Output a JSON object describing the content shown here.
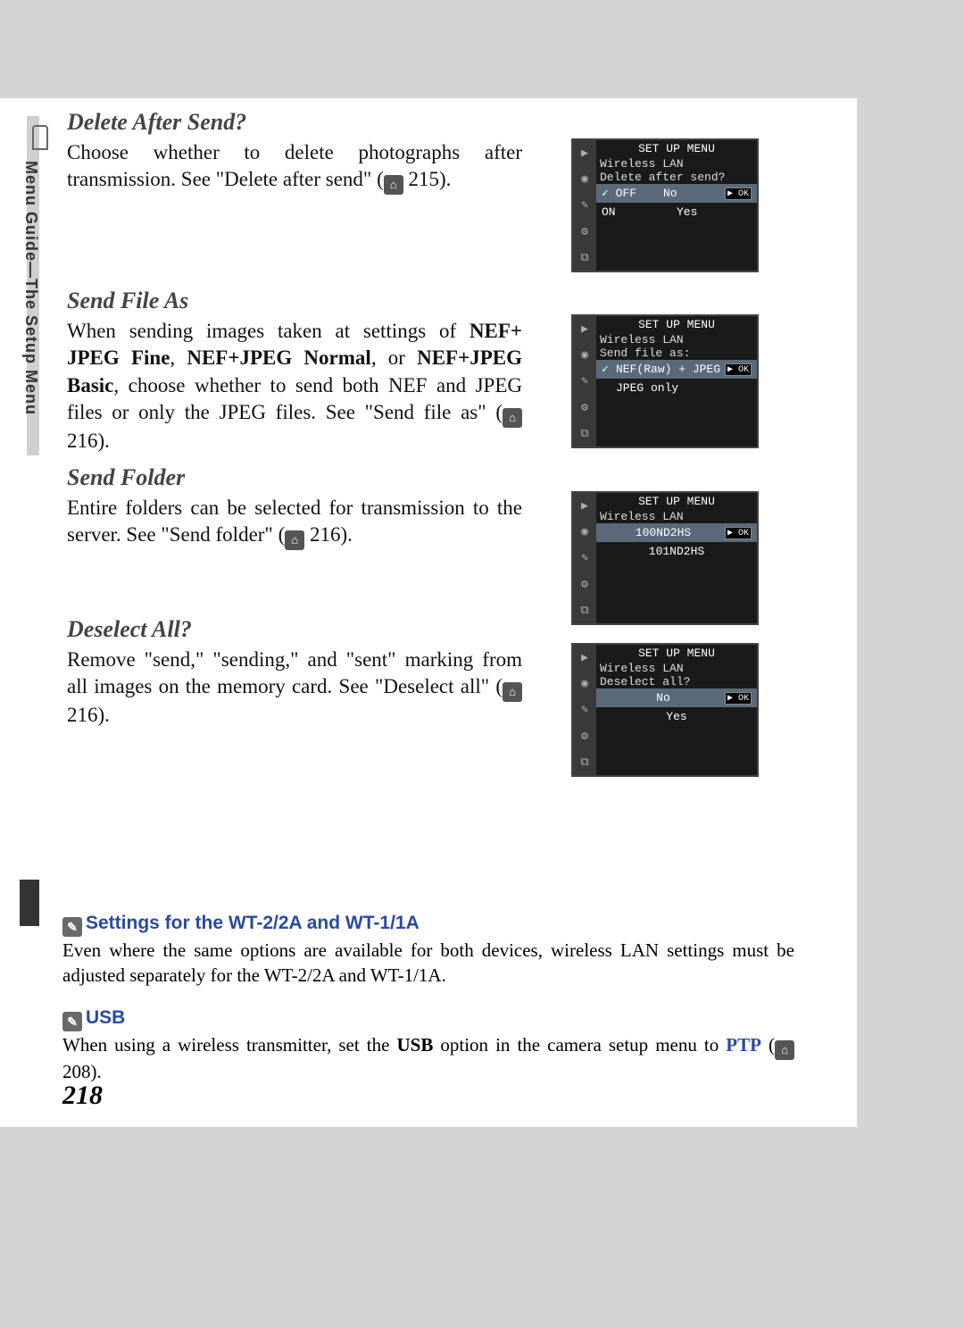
{
  "sidebar_label": "Menu Guide—The Setup Menu",
  "page_number": "218",
  "sections": {
    "s1": {
      "title": "Delete After Send?",
      "body_before": "Choose whether to delete photographs after transmission.  See \"Delete after send\" (",
      "ref": " 215)."
    },
    "s2": {
      "title": "Send File As",
      "body_p1": "When sending images taken at settings of ",
      "b1": "NEF+ JPEG Fine",
      "body_p2": ", ",
      "b2": "NEF+JPEG Normal",
      "body_p3": ", or ",
      "b3": "NEF+JPEG Basic",
      "body_p4": ", choose whether to send both NEF and JPEG files or only the JPEG files.  See \"Send file as\" (",
      "ref": " 216)."
    },
    "s3": {
      "title": "Send Folder",
      "body_before": "Entire folders can be selected for transmission to the server.  See \"Send folder\" (",
      "ref": " 216)."
    },
    "s4": {
      "title": "Deselect All?",
      "body_before": "Remove \"send,\" \"sending,\" and \"sent\" marking from all images on the memory card.  See \"Deselect all\" (",
      "ref": " 216)."
    }
  },
  "cam": {
    "header": "SET UP MENU",
    "sub": "Wireless LAN",
    "c1": {
      "prompt": "Delete after send?",
      "opt1_pre": "✓ OFF",
      "opt1": "No",
      "opt2_pre": "ON",
      "opt2": "Yes"
    },
    "c2": {
      "prompt": "Send file as:",
      "opt1": "NEF(Raw) + JPEG",
      "opt2": "JPEG only"
    },
    "c3": {
      "opt1": "100ND2HS",
      "opt2": "101ND2HS"
    },
    "c4": {
      "prompt": "Deselect all?",
      "opt1": "No",
      "opt2": "Yes"
    },
    "ok": "OK"
  },
  "notes": {
    "n1": {
      "title": "Settings for the WT-2/2A and WT-1/1A",
      "body": "Even where the same options are available for both devices, wireless LAN settings must be adjusted separately for the WT-2/2A and WT-1/1A."
    },
    "n2": {
      "title": "USB",
      "body_p1": "When using a wireless transmitter, set the ",
      "b1": "USB",
      "body_p2": " option in the camera setup menu to ",
      "b2": "PTP",
      "body_p3": " (",
      "ref": " 208)."
    }
  }
}
